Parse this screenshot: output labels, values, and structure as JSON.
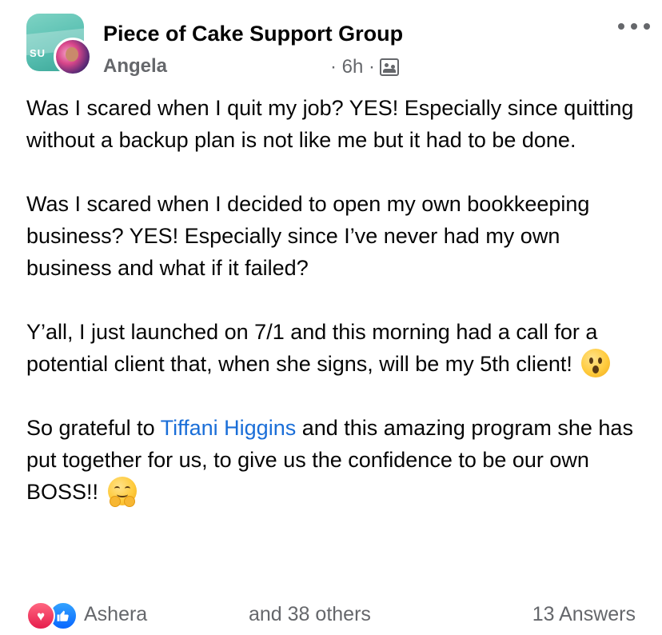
{
  "header": {
    "group_name": "Piece of Cake Support Group",
    "author": "Angela",
    "time": "· 6h ·",
    "group_avatar_text": "SU",
    "audience_icon": "group-audience-icon"
  },
  "post": {
    "p1": "Was I scared when I quit my job? YES! Especially since quitting without a backup plan is not like me but it had to be done.",
    "p2": "Was I scared when I decided to open my own bookkeeping business? YES! Especially since I’ve never had my own business and what if it failed?",
    "p3": "Y’all, I just launched on 7/1 and this morning had a call for a potential client that, when she signs, will be my 5th client!",
    "p4_before": "So grateful to ",
    "mention": "Tiffani Higgins",
    "p4_after": " and this amazing program she has put together for us, to give us the confidence to be our own BOSS!!",
    "emoji_1": "surprised-face-emoji",
    "emoji_2": "hugging-face-emoji"
  },
  "footer": {
    "reactor_name": "Ashera",
    "reactor_others": "and 38 others",
    "answers": "13 Answers",
    "reactions": [
      "love",
      "like"
    ]
  },
  "colors": {
    "mention": "#1a6ed8",
    "secondary_text": "#65676b",
    "love": "#e61e4d",
    "like": "#0866ff"
  }
}
